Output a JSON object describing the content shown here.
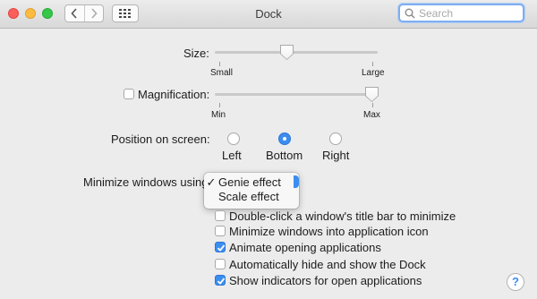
{
  "window": {
    "title": "Dock"
  },
  "search": {
    "placeholder": "Search"
  },
  "size": {
    "label": "Size:",
    "min_label": "Small",
    "max_label": "Large",
    "value_fraction": 0.44
  },
  "magnification": {
    "label": "Magnification:",
    "checked": false,
    "min_label": "Min",
    "max_label": "Max",
    "value_fraction": 1.0
  },
  "position": {
    "label": "Position on screen:",
    "options": [
      "Left",
      "Bottom",
      "Right"
    ],
    "selected": "Bottom"
  },
  "minimize": {
    "label": "Minimize windows using",
    "options": [
      "Genie effect",
      "Scale effect"
    ],
    "checkmark": "✓",
    "selected": "Genie effect"
  },
  "options": [
    {
      "label": "Double-click a window's title bar to minimize",
      "checked": false
    },
    {
      "label": "Minimize windows into application icon",
      "checked": false
    },
    {
      "label": "Animate opening applications",
      "checked": true
    },
    {
      "label": "Automatically hide and show the Dock",
      "checked": false
    },
    {
      "label": "Show indicators for open applications",
      "checked": true
    }
  ],
  "help": {
    "symbol": "?"
  },
  "colors": {
    "accent": "#3b8ef0"
  }
}
